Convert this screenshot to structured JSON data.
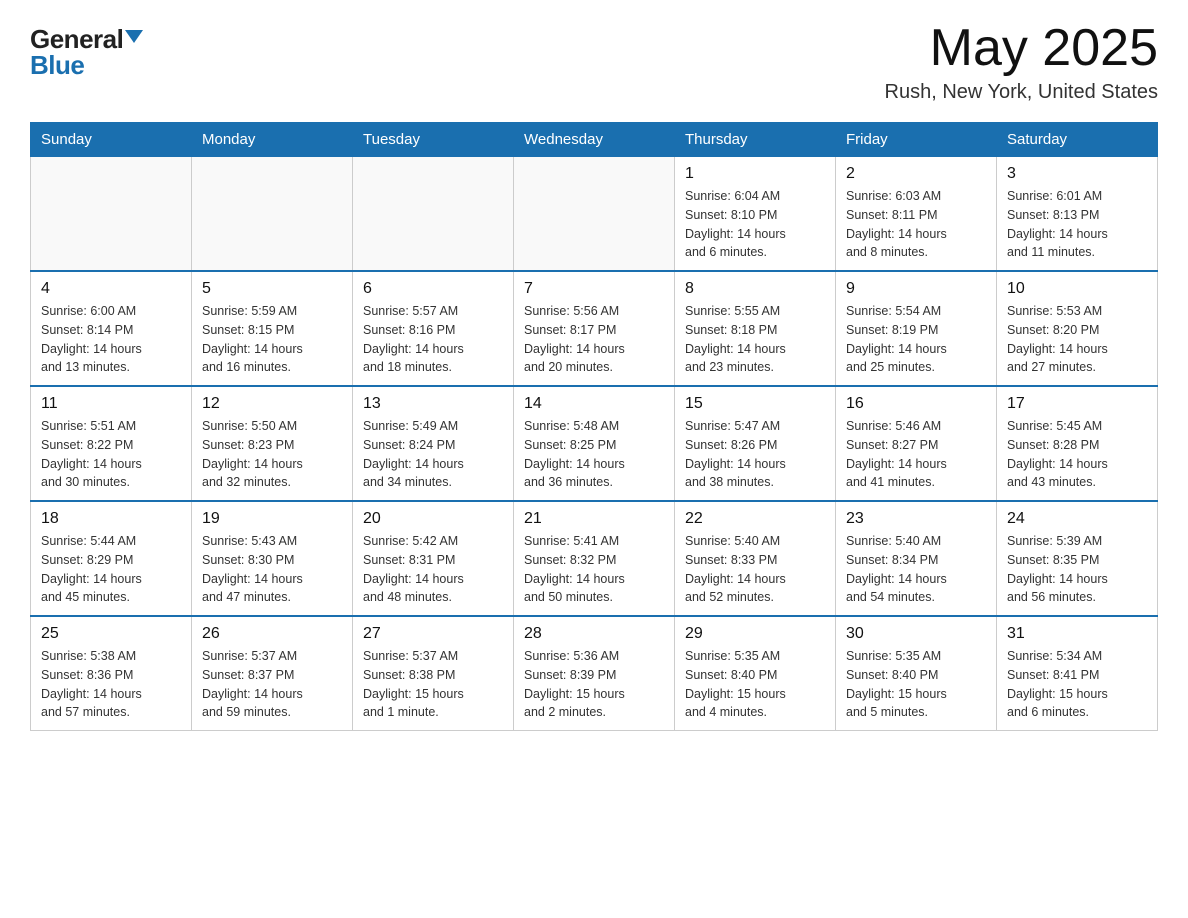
{
  "header": {
    "logo_general": "General",
    "logo_blue": "Blue",
    "month_title": "May 2025",
    "location": "Rush, New York, United States"
  },
  "days_of_week": [
    "Sunday",
    "Monday",
    "Tuesday",
    "Wednesday",
    "Thursday",
    "Friday",
    "Saturday"
  ],
  "weeks": [
    [
      {
        "day": "",
        "info": ""
      },
      {
        "day": "",
        "info": ""
      },
      {
        "day": "",
        "info": ""
      },
      {
        "day": "",
        "info": ""
      },
      {
        "day": "1",
        "info": "Sunrise: 6:04 AM\nSunset: 8:10 PM\nDaylight: 14 hours\nand 6 minutes."
      },
      {
        "day": "2",
        "info": "Sunrise: 6:03 AM\nSunset: 8:11 PM\nDaylight: 14 hours\nand 8 minutes."
      },
      {
        "day": "3",
        "info": "Sunrise: 6:01 AM\nSunset: 8:13 PM\nDaylight: 14 hours\nand 11 minutes."
      }
    ],
    [
      {
        "day": "4",
        "info": "Sunrise: 6:00 AM\nSunset: 8:14 PM\nDaylight: 14 hours\nand 13 minutes."
      },
      {
        "day": "5",
        "info": "Sunrise: 5:59 AM\nSunset: 8:15 PM\nDaylight: 14 hours\nand 16 minutes."
      },
      {
        "day": "6",
        "info": "Sunrise: 5:57 AM\nSunset: 8:16 PM\nDaylight: 14 hours\nand 18 minutes."
      },
      {
        "day": "7",
        "info": "Sunrise: 5:56 AM\nSunset: 8:17 PM\nDaylight: 14 hours\nand 20 minutes."
      },
      {
        "day": "8",
        "info": "Sunrise: 5:55 AM\nSunset: 8:18 PM\nDaylight: 14 hours\nand 23 minutes."
      },
      {
        "day": "9",
        "info": "Sunrise: 5:54 AM\nSunset: 8:19 PM\nDaylight: 14 hours\nand 25 minutes."
      },
      {
        "day": "10",
        "info": "Sunrise: 5:53 AM\nSunset: 8:20 PM\nDaylight: 14 hours\nand 27 minutes."
      }
    ],
    [
      {
        "day": "11",
        "info": "Sunrise: 5:51 AM\nSunset: 8:22 PM\nDaylight: 14 hours\nand 30 minutes."
      },
      {
        "day": "12",
        "info": "Sunrise: 5:50 AM\nSunset: 8:23 PM\nDaylight: 14 hours\nand 32 minutes."
      },
      {
        "day": "13",
        "info": "Sunrise: 5:49 AM\nSunset: 8:24 PM\nDaylight: 14 hours\nand 34 minutes."
      },
      {
        "day": "14",
        "info": "Sunrise: 5:48 AM\nSunset: 8:25 PM\nDaylight: 14 hours\nand 36 minutes."
      },
      {
        "day": "15",
        "info": "Sunrise: 5:47 AM\nSunset: 8:26 PM\nDaylight: 14 hours\nand 38 minutes."
      },
      {
        "day": "16",
        "info": "Sunrise: 5:46 AM\nSunset: 8:27 PM\nDaylight: 14 hours\nand 41 minutes."
      },
      {
        "day": "17",
        "info": "Sunrise: 5:45 AM\nSunset: 8:28 PM\nDaylight: 14 hours\nand 43 minutes."
      }
    ],
    [
      {
        "day": "18",
        "info": "Sunrise: 5:44 AM\nSunset: 8:29 PM\nDaylight: 14 hours\nand 45 minutes."
      },
      {
        "day": "19",
        "info": "Sunrise: 5:43 AM\nSunset: 8:30 PM\nDaylight: 14 hours\nand 47 minutes."
      },
      {
        "day": "20",
        "info": "Sunrise: 5:42 AM\nSunset: 8:31 PM\nDaylight: 14 hours\nand 48 minutes."
      },
      {
        "day": "21",
        "info": "Sunrise: 5:41 AM\nSunset: 8:32 PM\nDaylight: 14 hours\nand 50 minutes."
      },
      {
        "day": "22",
        "info": "Sunrise: 5:40 AM\nSunset: 8:33 PM\nDaylight: 14 hours\nand 52 minutes."
      },
      {
        "day": "23",
        "info": "Sunrise: 5:40 AM\nSunset: 8:34 PM\nDaylight: 14 hours\nand 54 minutes."
      },
      {
        "day": "24",
        "info": "Sunrise: 5:39 AM\nSunset: 8:35 PM\nDaylight: 14 hours\nand 56 minutes."
      }
    ],
    [
      {
        "day": "25",
        "info": "Sunrise: 5:38 AM\nSunset: 8:36 PM\nDaylight: 14 hours\nand 57 minutes."
      },
      {
        "day": "26",
        "info": "Sunrise: 5:37 AM\nSunset: 8:37 PM\nDaylight: 14 hours\nand 59 minutes."
      },
      {
        "day": "27",
        "info": "Sunrise: 5:37 AM\nSunset: 8:38 PM\nDaylight: 15 hours\nand 1 minute."
      },
      {
        "day": "28",
        "info": "Sunrise: 5:36 AM\nSunset: 8:39 PM\nDaylight: 15 hours\nand 2 minutes."
      },
      {
        "day": "29",
        "info": "Sunrise: 5:35 AM\nSunset: 8:40 PM\nDaylight: 15 hours\nand 4 minutes."
      },
      {
        "day": "30",
        "info": "Sunrise: 5:35 AM\nSunset: 8:40 PM\nDaylight: 15 hours\nand 5 minutes."
      },
      {
        "day": "31",
        "info": "Sunrise: 5:34 AM\nSunset: 8:41 PM\nDaylight: 15 hours\nand 6 minutes."
      }
    ]
  ]
}
